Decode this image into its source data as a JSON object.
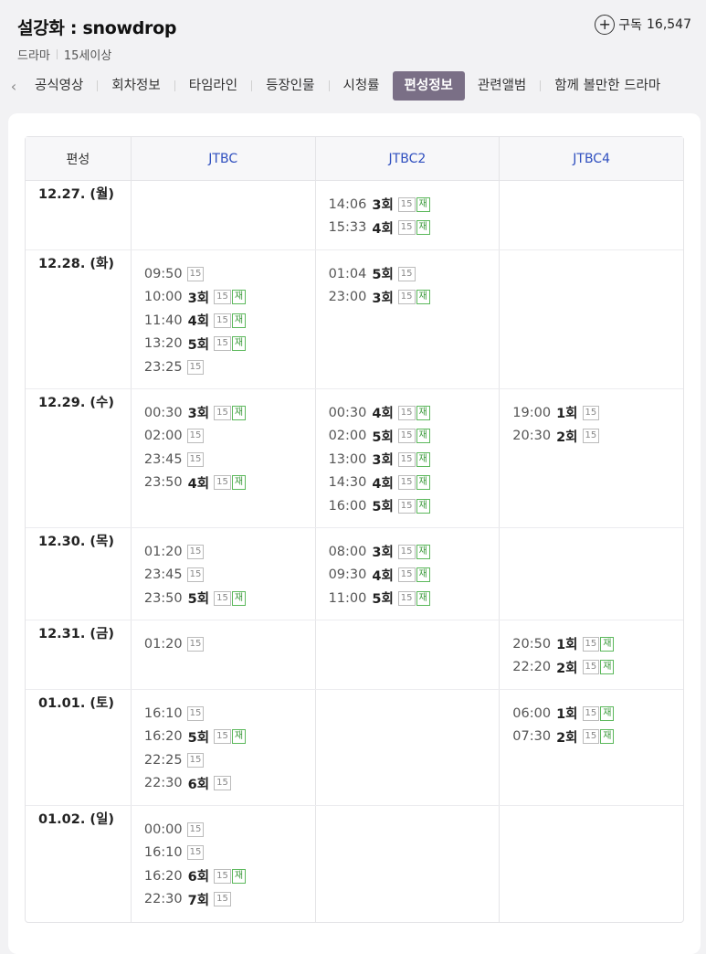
{
  "header": {
    "title": "설강화 : snowdrop",
    "genre": "드라마",
    "rating": "15세이상",
    "subscribe_label": "구독",
    "subscribe_count": "16,547"
  },
  "tabs": [
    {
      "label": "공식영상",
      "active": false
    },
    {
      "label": "회차정보",
      "active": false
    },
    {
      "label": "타임라인",
      "active": false
    },
    {
      "label": "등장인물",
      "active": false
    },
    {
      "label": "시청률",
      "active": false
    },
    {
      "label": "편성정보",
      "active": true
    },
    {
      "label": "관련앨범",
      "active": false
    },
    {
      "label": "함께 볼만한 드라마",
      "active": false
    }
  ],
  "table": {
    "headers": [
      "편성",
      "JTBC",
      "JTBC2",
      "JTBC4"
    ],
    "rows": [
      {
        "date": "12.27. (월)",
        "cols": [
          [],
          [
            {
              "time": "14:06",
              "ep": "3회",
              "age": "15",
              "re": "재"
            },
            {
              "time": "15:33",
              "ep": "4회",
              "age": "15",
              "re": "재"
            }
          ],
          []
        ]
      },
      {
        "date": "12.28. (화)",
        "cols": [
          [
            {
              "time": "09:50",
              "ep": "",
              "age": "15",
              "re": ""
            },
            {
              "time": "10:00",
              "ep": "3회",
              "age": "15",
              "re": "재"
            },
            {
              "time": "11:40",
              "ep": "4회",
              "age": "15",
              "re": "재"
            },
            {
              "time": "13:20",
              "ep": "5회",
              "age": "15",
              "re": "재"
            },
            {
              "time": "23:25",
              "ep": "",
              "age": "15",
              "re": ""
            }
          ],
          [
            {
              "time": "01:04",
              "ep": "5회",
              "age": "15",
              "re": ""
            },
            {
              "time": "23:00",
              "ep": "3회",
              "age": "15",
              "re": "재"
            }
          ],
          []
        ]
      },
      {
        "date": "12.29. (수)",
        "cols": [
          [
            {
              "time": "00:30",
              "ep": "3회",
              "age": "15",
              "re": "재"
            },
            {
              "time": "02:00",
              "ep": "",
              "age": "15",
              "re": ""
            },
            {
              "time": "23:45",
              "ep": "",
              "age": "15",
              "re": ""
            },
            {
              "time": "23:50",
              "ep": "4회",
              "age": "15",
              "re": "재"
            }
          ],
          [
            {
              "time": "00:30",
              "ep": "4회",
              "age": "15",
              "re": "재"
            },
            {
              "time": "02:00",
              "ep": "5회",
              "age": "15",
              "re": "재"
            },
            {
              "time": "13:00",
              "ep": "3회",
              "age": "15",
              "re": "재"
            },
            {
              "time": "14:30",
              "ep": "4회",
              "age": "15",
              "re": "재"
            },
            {
              "time": "16:00",
              "ep": "5회",
              "age": "15",
              "re": "재"
            }
          ],
          [
            {
              "time": "19:00",
              "ep": "1회",
              "age": "15",
              "re": ""
            },
            {
              "time": "20:30",
              "ep": "2회",
              "age": "15",
              "re": ""
            }
          ]
        ]
      },
      {
        "date": "12.30. (목)",
        "cols": [
          [
            {
              "time": "01:20",
              "ep": "",
              "age": "15",
              "re": ""
            },
            {
              "time": "23:45",
              "ep": "",
              "age": "15",
              "re": ""
            },
            {
              "time": "23:50",
              "ep": "5회",
              "age": "15",
              "re": "재"
            }
          ],
          [
            {
              "time": "08:00",
              "ep": "3회",
              "age": "15",
              "re": "재"
            },
            {
              "time": "09:30",
              "ep": "4회",
              "age": "15",
              "re": "재"
            },
            {
              "time": "11:00",
              "ep": "5회",
              "age": "15",
              "re": "재"
            }
          ],
          []
        ]
      },
      {
        "date": "12.31. (금)",
        "cols": [
          [
            {
              "time": "01:20",
              "ep": "",
              "age": "15",
              "re": ""
            }
          ],
          [],
          [
            {
              "time": "20:50",
              "ep": "1회",
              "age": "15",
              "re": "재"
            },
            {
              "time": "22:20",
              "ep": "2회",
              "age": "15",
              "re": "재"
            }
          ]
        ]
      },
      {
        "date": "01.01. (토)",
        "cols": [
          [
            {
              "time": "16:10",
              "ep": "",
              "age": "15",
              "re": ""
            },
            {
              "time": "16:20",
              "ep": "5회",
              "age": "15",
              "re": "재"
            },
            {
              "time": "22:25",
              "ep": "",
              "age": "15",
              "re": ""
            },
            {
              "time": "22:30",
              "ep": "6회",
              "age": "15",
              "re": ""
            }
          ],
          [],
          [
            {
              "time": "06:00",
              "ep": "1회",
              "age": "15",
              "re": "재"
            },
            {
              "time": "07:30",
              "ep": "2회",
              "age": "15",
              "re": "재"
            }
          ]
        ]
      },
      {
        "date": "01.02. (일)",
        "cols": [
          [
            {
              "time": "00:00",
              "ep": "",
              "age": "15",
              "re": ""
            },
            {
              "time": "16:10",
              "ep": "",
              "age": "15",
              "re": ""
            },
            {
              "time": "16:20",
              "ep": "6회",
              "age": "15",
              "re": "재"
            },
            {
              "time": "22:30",
              "ep": "7회",
              "age": "15",
              "re": ""
            }
          ],
          [],
          []
        ]
      }
    ]
  }
}
